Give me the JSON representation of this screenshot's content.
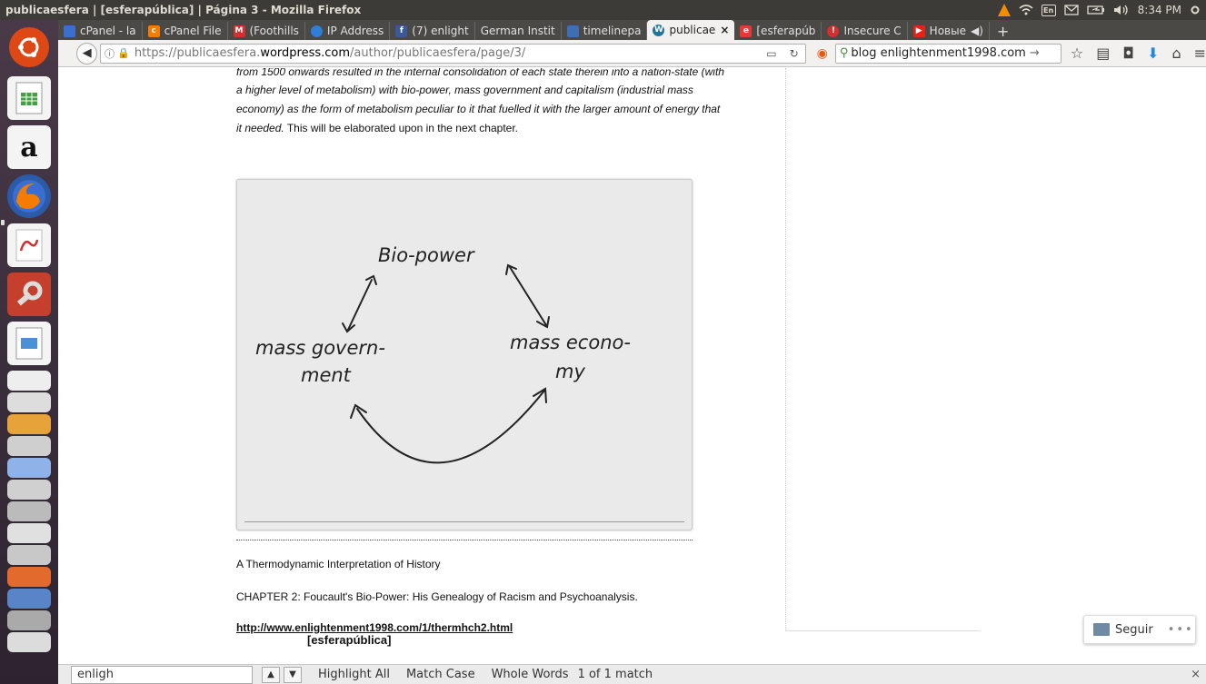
{
  "window": {
    "title": "publicaesfera | [esferapública] | Página 3 - Mozilla Firefox"
  },
  "top_panel": {
    "keyboard": "En",
    "time": "8:34 PM"
  },
  "tabs": [
    {
      "label": "cPanel - la",
      "icon": "cpanel-icon"
    },
    {
      "label": "cPanel File",
      "icon": "cpanel-file-icon"
    },
    {
      "label": "(Foothills",
      "icon": "mail-icon"
    },
    {
      "label": "IP Address",
      "icon": "globe-icon"
    },
    {
      "label": "(7) enlight",
      "icon": "facebook-icon"
    },
    {
      "label": "German Instit",
      "icon": ""
    },
    {
      "label": "timelinepa",
      "icon": "table-icon"
    },
    {
      "label": "publicae",
      "icon": "wordpress-icon",
      "active": true
    },
    {
      "label": "[esferapúb",
      "icon": "e-icon"
    },
    {
      "label": "Insecure C",
      "icon": "warning-icon"
    },
    {
      "label": "Новые",
      "icon": "youtube-icon"
    }
  ],
  "nav": {
    "url_prefix": "https://publicaesfera.",
    "url_host": "wordpress.com",
    "url_path": "/author/publicaesfera/page/3/",
    "search_text": "blog enlightenment1998.com"
  },
  "post": {
    "line1": "from 1500 onwards resulted in the internal consolidation of each state therein into a nation-state (with",
    "line2": "a higher level of metabolism) with bio-power, mass government and capitalism (industrial mass",
    "line3": "economy) as the form of metabolism peculiar to it that fuelled it with the larger amount of energy that",
    "line4_italic": "it needed.",
    "line4_rest": " This will be elaborated upon in the next chapter.",
    "figure": {
      "top": "Bio-power",
      "left_1": "mass govern-",
      "left_2": "ment",
      "right_1": "mass econo-",
      "right_2": "my"
    },
    "book_title": "A Thermodynamic Interpretation of History",
    "chapter": "CHAPTER 2: Foucault's Bio-Power: His Genealogy of Racism and Psychoanalysis.",
    "link": "http://www.enlightenment1998.com/1/thermhch2.html"
  },
  "site_title": "[esferapública]",
  "follow": {
    "label": "Seguir",
    "more": "•••"
  },
  "findbar": {
    "query": "enligh",
    "highlight_all": "Highlight All",
    "match_case": "Match Case",
    "whole_words": "Whole Words",
    "status": "1 of 1 match"
  }
}
